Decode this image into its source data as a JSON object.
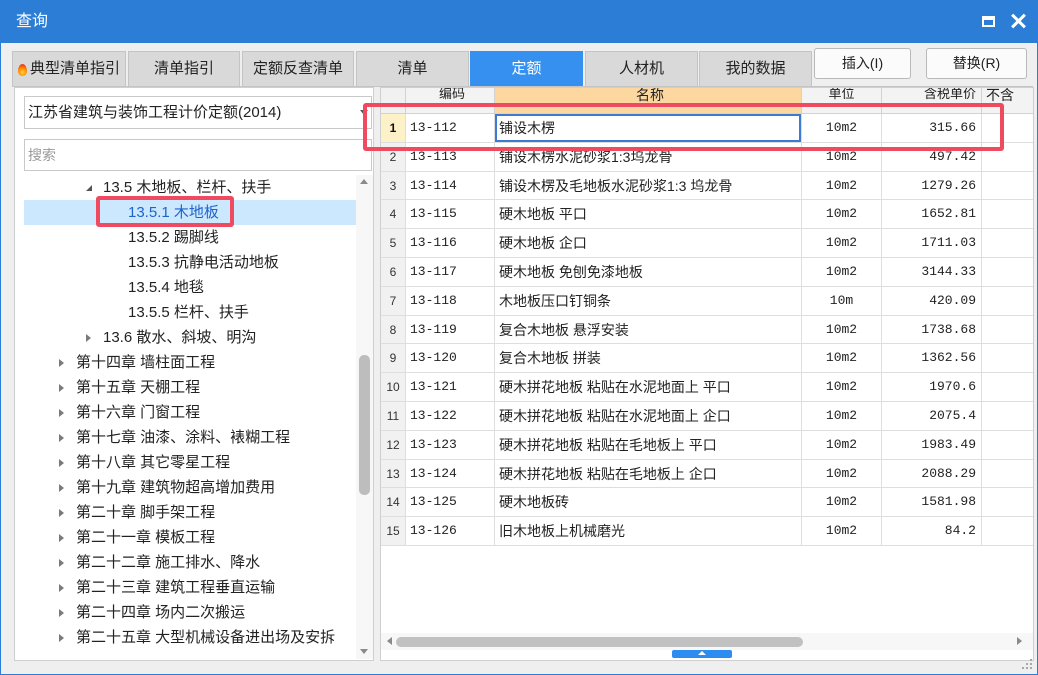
{
  "window": {
    "title": "查询"
  },
  "tabs": [
    {
      "label": "典型清单指引",
      "icon": "fire-icon",
      "active": false
    },
    {
      "label": "清单指引",
      "active": false
    },
    {
      "label": "定额反查清单",
      "active": false
    },
    {
      "label": "清单",
      "active": false
    },
    {
      "label": "定额",
      "active": true
    },
    {
      "label": "人材机",
      "active": false
    },
    {
      "label": "我的数据",
      "active": false
    }
  ],
  "actions": {
    "insert": "插入(I)",
    "replace": "替换(R)"
  },
  "library": {
    "selected": "江苏省建筑与装饰工程计价定额(2014)",
    "search_placeholder": "搜索"
  },
  "tree": {
    "items": [
      {
        "label": "13.5 木地板、栏杆、扶手",
        "expanded": true
      },
      {
        "label": "13.5.1 木地板",
        "selected": true
      },
      {
        "label": "13.5.2 踢脚线"
      },
      {
        "label": "13.5.3 抗静电活动地板"
      },
      {
        "label": "13.5.4 地毯"
      },
      {
        "label": "13.5.5 栏杆、扶手"
      },
      {
        "label": "13.6 散水、斜坡、明沟",
        "expanded": false
      },
      {
        "label": "第十四章 墙柱面工程",
        "expanded": false
      },
      {
        "label": "第十五章 天棚工程",
        "expanded": false
      },
      {
        "label": "第十六章 门窗工程",
        "expanded": false
      },
      {
        "label": "第十七章 油漆、涂料、裱糊工程",
        "expanded": false
      },
      {
        "label": "第十八章 其它零星工程",
        "expanded": false
      },
      {
        "label": "第十九章 建筑物超高增加费用",
        "expanded": false
      },
      {
        "label": "第二十章 脚手架工程",
        "expanded": false
      },
      {
        "label": "第二十一章 模板工程",
        "expanded": false
      },
      {
        "label": "第二十二章 施工排水、降水",
        "expanded": false
      },
      {
        "label": "第二十三章 建筑工程垂直运输",
        "expanded": false
      },
      {
        "label": "第二十四章 场内二次搬运",
        "expanded": false
      },
      {
        "label": "第二十五章 大型机械设备进出场及安拆",
        "expanded": false
      }
    ]
  },
  "table": {
    "columns": {
      "code": "编码",
      "name": "名称",
      "unit": "单位",
      "price_incl_tax": "含税单价",
      "price_excl_tax": "不含"
    },
    "rows": [
      {
        "no": "1",
        "code": "13-112",
        "name": "铺设木楞",
        "unit": "10m2",
        "price": "315.66",
        "selected": true
      },
      {
        "no": "2",
        "code": "13-113",
        "name": "铺设木楞水泥砂浆1:3坞龙骨",
        "unit": "10m2",
        "price": "497.42"
      },
      {
        "no": "3",
        "code": "13-114",
        "name": "铺设木楞及毛地板水泥砂浆1:3 坞龙骨",
        "unit": "10m2",
        "price": "1279.26"
      },
      {
        "no": "4",
        "code": "13-115",
        "name": "硬木地板 平口",
        "unit": "10m2",
        "price": "1652.81"
      },
      {
        "no": "5",
        "code": "13-116",
        "name": "硬木地板 企口",
        "unit": "10m2",
        "price": "1711.03"
      },
      {
        "no": "6",
        "code": "13-117",
        "name": "硬木地板 免刨免漆地板",
        "unit": "10m2",
        "price": "3144.33"
      },
      {
        "no": "7",
        "code": "13-118",
        "name": "木地板压口钉铜条",
        "unit": "10m",
        "price": "420.09"
      },
      {
        "no": "8",
        "code": "13-119",
        "name": "复合木地板 悬浮安装",
        "unit": "10m2",
        "price": "1738.68"
      },
      {
        "no": "9",
        "code": "13-120",
        "name": "复合木地板 拼装",
        "unit": "10m2",
        "price": "1362.56"
      },
      {
        "no": "10",
        "code": "13-121",
        "name": "硬木拼花地板 粘贴在水泥地面上 平口",
        "unit": "10m2",
        "price": "1970.6"
      },
      {
        "no": "11",
        "code": "13-122",
        "name": "硬木拼花地板 粘贴在水泥地面上 企口",
        "unit": "10m2",
        "price": "2075.4"
      },
      {
        "no": "12",
        "code": "13-123",
        "name": "硬木拼花地板 粘贴在毛地板上 平口",
        "unit": "10m2",
        "price": "1983.49"
      },
      {
        "no": "13",
        "code": "13-124",
        "name": "硬木拼花地板 粘贴在毛地板上 企口",
        "unit": "10m2",
        "price": "2088.29"
      },
      {
        "no": "14",
        "code": "13-125",
        "name": "硬木地板砖",
        "unit": "10m2",
        "price": "1581.98"
      },
      {
        "no": "15",
        "code": "13-126",
        "name": "旧木地板上机械磨光",
        "unit": "10m2",
        "price": "84.2"
      }
    ]
  },
  "icons": {
    "maximize": "maximize-icon",
    "close": "close-icon",
    "typical_tab": "fire-icon",
    "dropdown": "chevron-down-icon",
    "tree_expanded": "triangle-expanded-icon",
    "tree_collapsed": "triangle-collapsed-icon",
    "resize": "resize-grip-icon"
  },
  "colors": {
    "accent": "#2b7dd6",
    "active_tab": "#3590f0",
    "selection": "#cce8ff",
    "header_highlight": "#fcd7a0",
    "row_marker": "#fdf1c7",
    "annotation": "#ef4a60"
  }
}
